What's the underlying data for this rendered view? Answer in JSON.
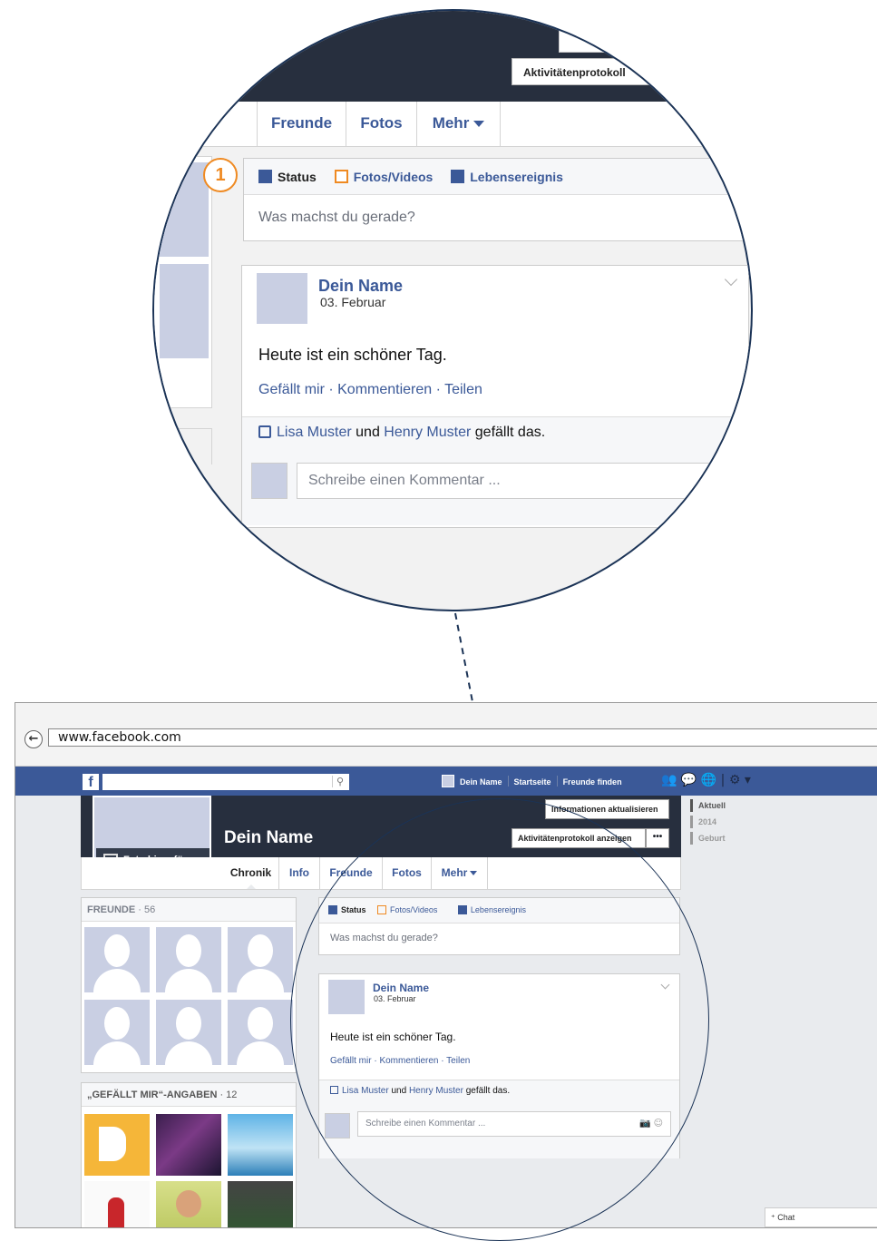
{
  "zoom": {
    "step_badge": "1",
    "activity_button": "Aktivitätenprotokoll",
    "tabs": {
      "info": "fo",
      "friends": "Freunde",
      "photos": "Fotos",
      "more": "Mehr"
    },
    "composer": {
      "status": "Status",
      "photos_videos": "Fotos/Videos",
      "life_event": "Lebensereignis",
      "placeholder": "Was machst du gerade?"
    },
    "post": {
      "name": "Dein Name",
      "date": "03. Februar",
      "text": "Heute ist ein schöner Tag.",
      "actions": "Gefällt mir · Kommentieren · Teilen",
      "like_user1": "Lisa Muster",
      "like_and": " und ",
      "like_user2": "Henry Muster",
      "like_suffix": " gefällt das.",
      "comment_placeholder": "Schreibe einen Kommentar ..."
    }
  },
  "browser": {
    "back_icon": "←",
    "url": "www.facebook.com",
    "nav": {
      "logo": "f",
      "search_icon": "⚲",
      "profile_name": "Dein Name",
      "home": "Startseite",
      "find_friends": "Freunde finden",
      "icons": "👥 💬 🌐 | ⚙ ▾"
    },
    "profile": {
      "name": "Dein Name",
      "add_photo": "Foto hinzufügen",
      "update_info": "Informationen aktualisieren",
      "activity_log": "Aktivitätenprotokoll anzeigen",
      "more_dots": "•••"
    },
    "tabs": {
      "chronicle": "Chronik",
      "info": "Info",
      "friends": "Freunde",
      "photos": "Fotos",
      "more": "Mehr"
    },
    "timeline": {
      "current": "Aktuell",
      "year": "2014",
      "birth": "Geburt"
    },
    "friends_box": {
      "title": "FREUNDE",
      "count": " · 56"
    },
    "likes_box": {
      "title": "„GEFÄLLT MIR“-ANGABEN",
      "count": " · 12"
    },
    "composer": {
      "status": "Status",
      "photos_videos": "Fotos/Videos",
      "life_event": "Lebensereignis",
      "placeholder": "Was machst du gerade?"
    },
    "post": {
      "name": "Dein Name",
      "date": "03. Februar",
      "text": "Heute ist ein schöner Tag.",
      "actions": "Gefällt mir · Kommentieren · Teilen",
      "like_user1": "Lisa Muster",
      "like_and": " und ",
      "like_user2": "Henry Muster",
      "like_suffix": " gefällt das.",
      "comment_placeholder": "Schreibe einen Kommentar ...",
      "comment_icons": "📷 ☺"
    },
    "chat": "Chat"
  },
  "colors": {
    "facebook_blue": "#3b5998",
    "cover_dark": "#272f3e",
    "accent_orange": "#ef8a22",
    "outline_navy": "#1b3356"
  }
}
